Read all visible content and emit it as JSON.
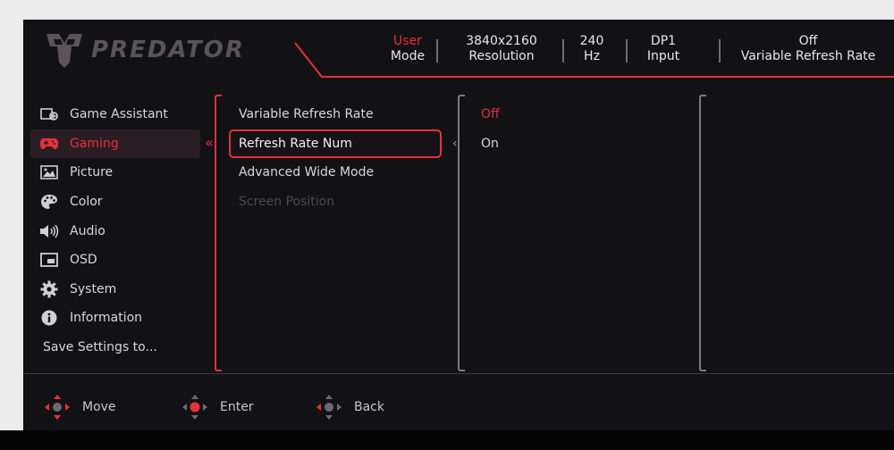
{
  "brand": {
    "name": "PREDATOR"
  },
  "status": [
    {
      "top": "User",
      "bottom": "Mode",
      "top_accent": true
    },
    {
      "top": "3840x2160",
      "bottom": "Resolution"
    },
    {
      "top": "240",
      "bottom": "Hz"
    },
    {
      "top": "DP1",
      "bottom": "Input"
    },
    {
      "top": "Off",
      "bottom": "Variable Refresh Rate"
    }
  ],
  "side_menu": [
    {
      "label": "Game Assistant",
      "icon": "game-assistant-icon"
    },
    {
      "label": "Gaming",
      "icon": "gamepad-icon",
      "active": true
    },
    {
      "label": "Picture",
      "icon": "picture-icon"
    },
    {
      "label": "Color",
      "icon": "palette-icon"
    },
    {
      "label": "Audio",
      "icon": "speaker-icon"
    },
    {
      "label": "OSD",
      "icon": "osd-icon"
    },
    {
      "label": "System",
      "icon": "gear-icon"
    },
    {
      "label": "Information",
      "icon": "info-icon"
    },
    {
      "label": "Save Settings to..."
    }
  ],
  "sub_menu": [
    {
      "label": "Variable Refresh Rate"
    },
    {
      "label": "Refresh Rate Num",
      "selected": true
    },
    {
      "label": "Advanced Wide Mode"
    },
    {
      "label": "Screen Position",
      "disabled": true
    }
  ],
  "options": [
    {
      "label": "Off",
      "current": true
    },
    {
      "label": "On"
    }
  ],
  "footer": [
    {
      "label": "Move",
      "icon": "dpad-move-icon"
    },
    {
      "label": "Enter",
      "icon": "dpad-enter-icon"
    },
    {
      "label": "Back",
      "icon": "dpad-back-icon"
    }
  ],
  "colors": {
    "accent": "#e8303a",
    "text": "#d8d8dc",
    "disabled": "#4a4a50",
    "background": "#121215"
  }
}
